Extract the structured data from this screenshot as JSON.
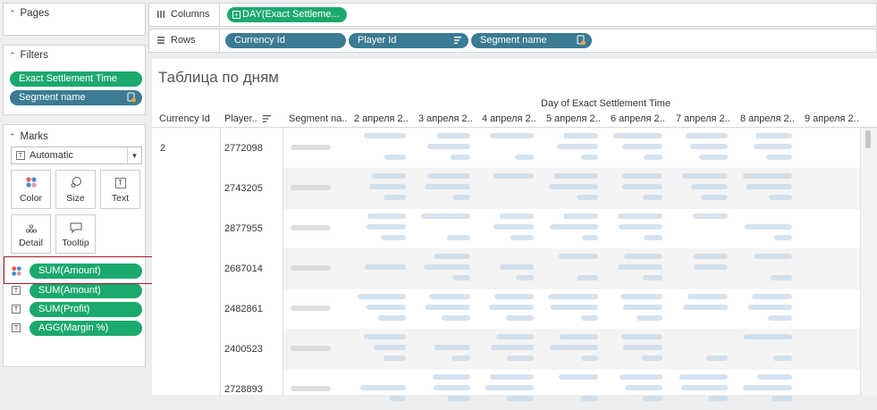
{
  "pages": {
    "title": "Pages"
  },
  "filters": {
    "title": "Filters",
    "items": [
      "Exact Settlement Time",
      "Segment name"
    ]
  },
  "marks": {
    "title": "Marks",
    "type": "Automatic",
    "buttons": [
      "Color",
      "Size",
      "Text",
      "Detail",
      "Tooltip"
    ],
    "fields": [
      "SUM(Amount)",
      "SUM(Amount)",
      "SUM(Profit)",
      "AGG(Margin %)"
    ]
  },
  "shelves": {
    "columns_label": "Columns",
    "columns_pill": "DAY(Exact Settleme...",
    "rows_label": "Rows",
    "rows_pills": [
      "Currency Id",
      "Player Id",
      "Segment name"
    ]
  },
  "view": {
    "title": "Таблица по дням",
    "column_super_header": "Day of Exact Settlement Time",
    "row_headers": [
      "Currency Id",
      "Player..",
      "Segment na.."
    ],
    "day_headers": [
      "2 апреля 2..",
      "3 апреля 2..",
      "4 апреля 2..",
      "5 апреля 2..",
      "6 апреля 2..",
      "7 апреля 2..",
      "8 апреля 2..",
      "9 апреля 2.."
    ],
    "currency_id": "2",
    "player_ids": [
      "2772098",
      "2743205",
      "2877955",
      "2687014",
      "2482861",
      "2400523",
      "2728893"
    ]
  },
  "colors": {
    "pill_green": "#1ca96d",
    "pill_blue": "#3b7b93",
    "highlight": "#a21c2a"
  }
}
